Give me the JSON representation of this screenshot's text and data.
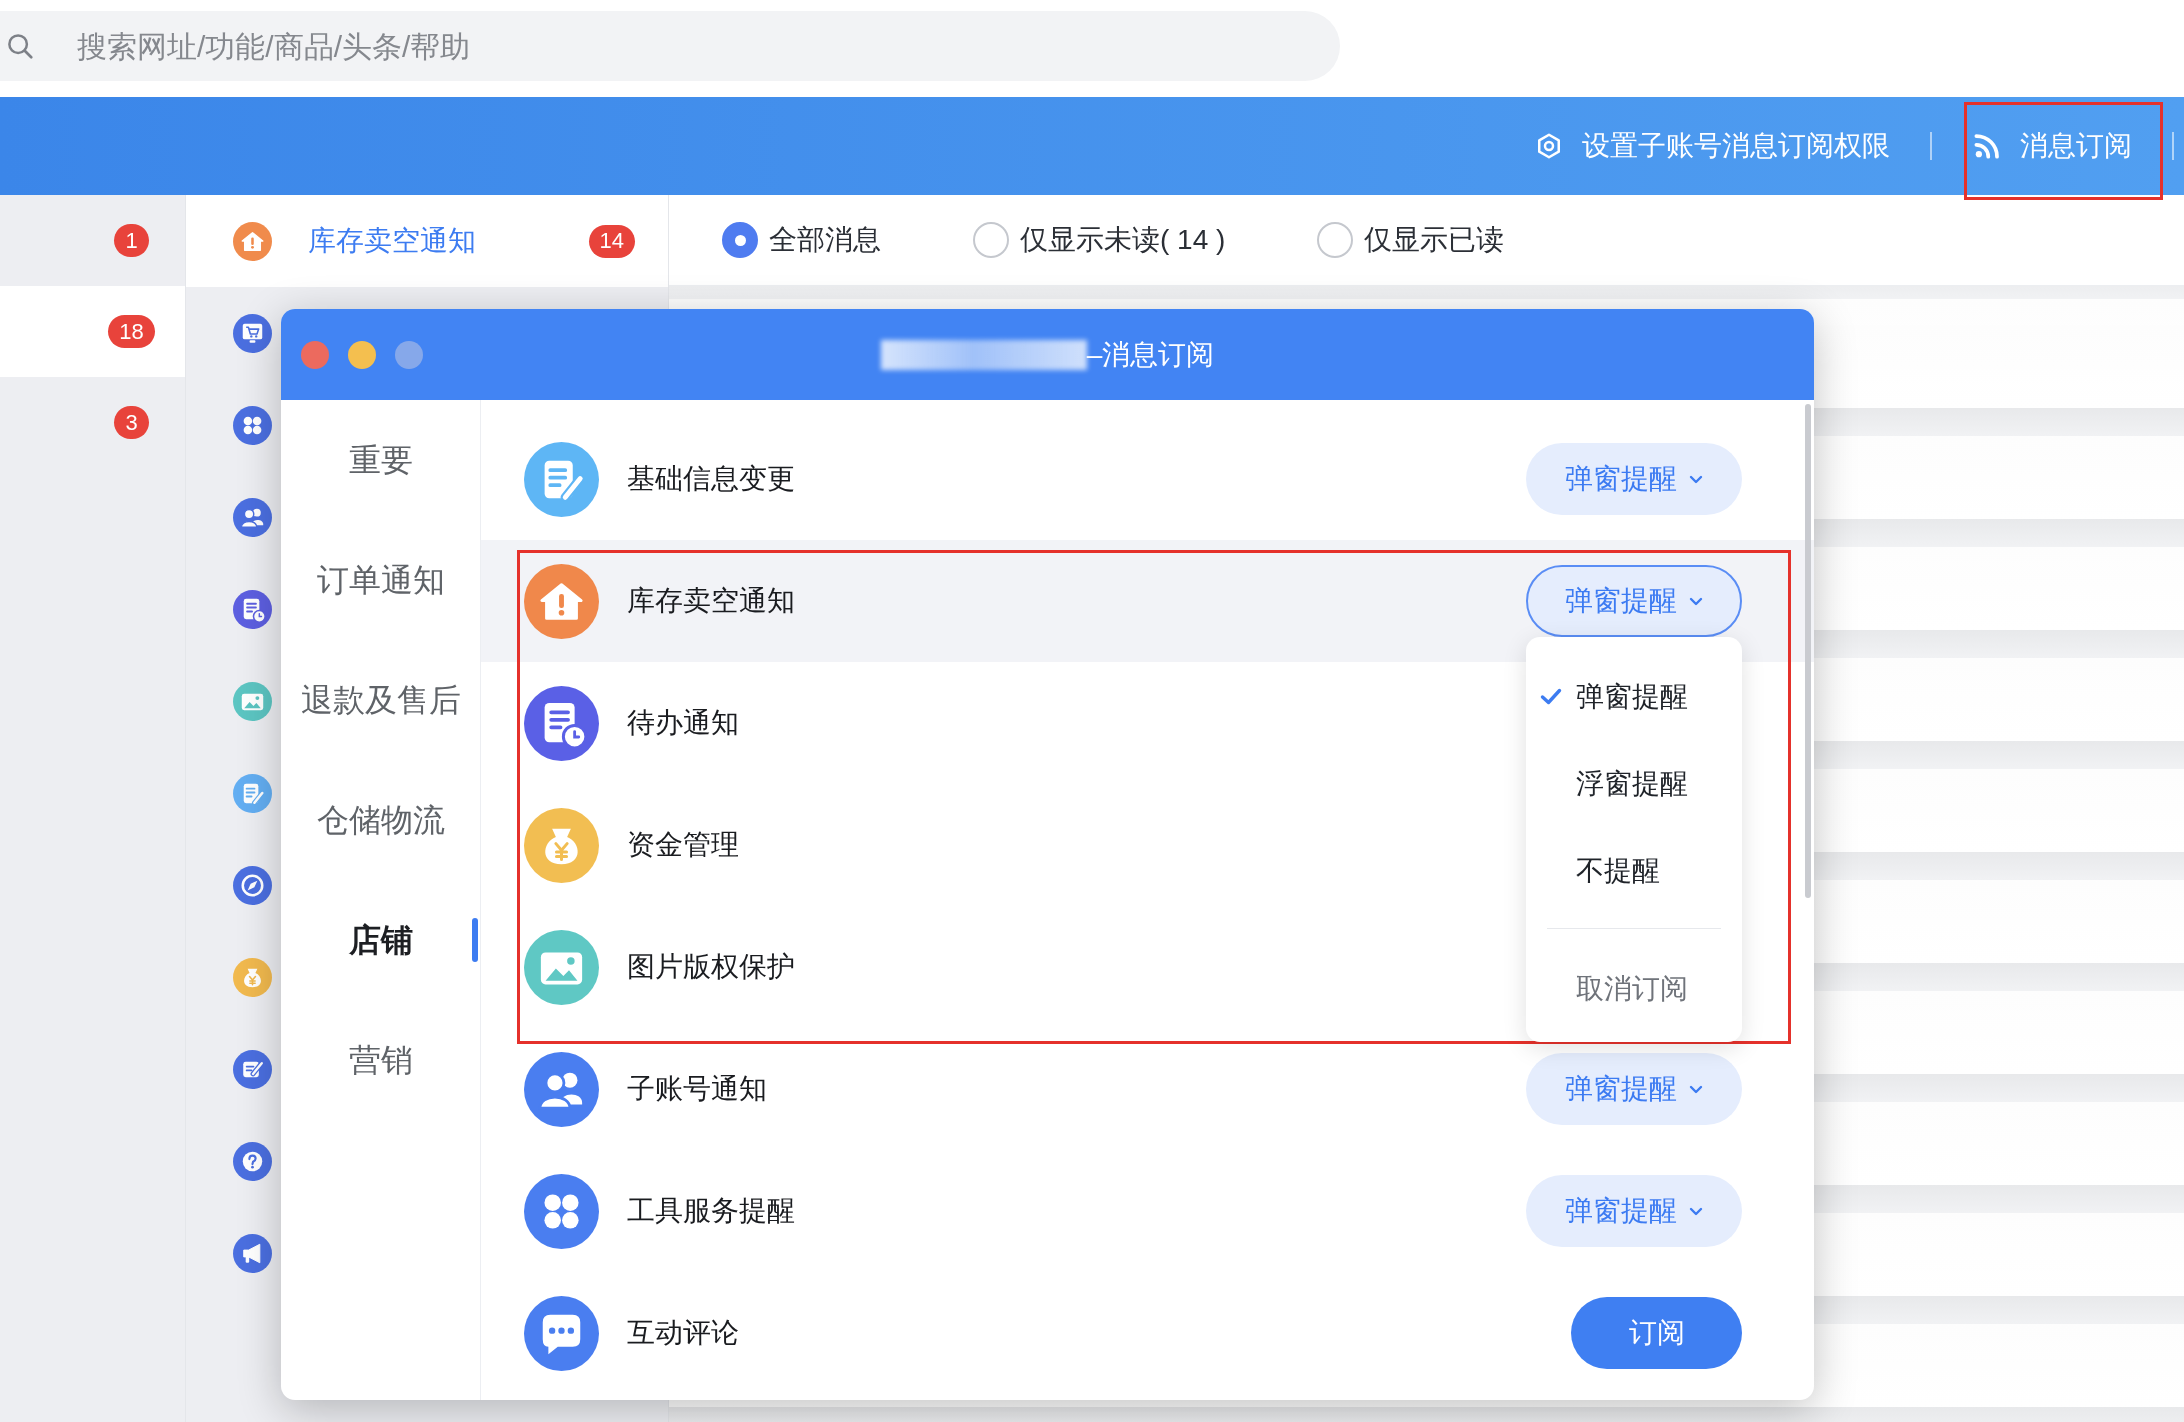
{
  "search": {
    "placeholder": "搜索网址/功能/商品/头条/帮助"
  },
  "header_links": [
    {
      "kind": "settings",
      "label": "设置子账号消息订阅权限",
      "highlighted": false
    },
    {
      "kind": "feed",
      "label": "消息订阅",
      "highlighted": true
    }
  ],
  "category_list": [
    {
      "badge": "1",
      "selected": false
    },
    {
      "badge": "18",
      "selected": true
    },
    {
      "badge": "3",
      "selected": false
    }
  ],
  "topic_list": [
    {
      "kind": "stock",
      "color": "#f08b4c",
      "label": "库存卖空通知",
      "badge": "14",
      "selected": true
    },
    {
      "kind": "cart",
      "color": "#4b6fe0",
      "selected": false
    },
    {
      "kind": "tools",
      "color": "#4b6fe0",
      "selected": false
    },
    {
      "kind": "accounts",
      "color": "#4b6fe0",
      "selected": false
    },
    {
      "kind": "todo",
      "color": "#5d5fe0",
      "selected": false
    },
    {
      "kind": "image",
      "color": "#5cc5c2",
      "selected": false
    },
    {
      "kind": "document",
      "color": "#63aef2",
      "selected": false
    },
    {
      "kind": "compass",
      "color": "#4b6fe0",
      "selected": false
    },
    {
      "kind": "funds",
      "color": "#f1b94e",
      "selected": false
    },
    {
      "kind": "edit",
      "color": "#4b6fe0",
      "selected": false
    },
    {
      "kind": "help",
      "color": "#4b6fe0",
      "selected": false
    },
    {
      "kind": "megaphone",
      "color": "#4b6fe0",
      "selected": false
    }
  ],
  "filters": [
    {
      "label": "全部消息",
      "selected": true
    },
    {
      "label": "仅显示未读( 14 )",
      "selected": false
    },
    {
      "label": "仅显示已读",
      "selected": false
    }
  ],
  "dialog": {
    "window_buttons": [
      {
        "kind": "close",
        "disabled": false
      },
      {
        "kind": "minimize",
        "disabled": false
      },
      {
        "kind": "zoom",
        "disabled": true
      }
    ],
    "title_redacted": true,
    "title": "–消息订阅",
    "nav": [
      {
        "label": "重要",
        "selected": false
      },
      {
        "label": "订单通知",
        "selected": false
      },
      {
        "label": "退款及售后",
        "selected": false
      },
      {
        "label": "仓储物流",
        "selected": false
      },
      {
        "label": "店铺",
        "selected": true
      },
      {
        "label": "营销",
        "selected": false
      }
    ],
    "groups": [
      {
        "highlighted": false,
        "rows": [
          {
            "kind": "document",
            "color": "#5eb6f5",
            "label": "基础信息变更",
            "expanded": false,
            "action": {
              "kind": "dropdown",
              "label": "弹窗提醒"
            }
          }
        ]
      },
      {
        "highlighted": true,
        "rows": [
          {
            "kind": "stock",
            "color": "#f0884b",
            "label": "库存卖空通知",
            "expanded": true,
            "action": {
              "kind": "dropdown",
              "label": "弹窗提醒",
              "menu": [
                {
                  "kind": "option",
                  "label": "弹窗提醒",
                  "checked": true
                },
                {
                  "kind": "option",
                  "label": "浮窗提醒",
                  "checked": false
                },
                {
                  "kind": "option",
                  "label": "不提醒",
                  "checked": false
                },
                {
                  "kind": "divider"
                },
                {
                  "kind": "action",
                  "label": "取消订阅"
                }
              ]
            }
          },
          {
            "kind": "todo",
            "color": "#5a60e6",
            "label": "待办通知",
            "expanded": false
          },
          {
            "kind": "funds",
            "color": "#f2be52",
            "label": "资金管理",
            "expanded": false
          },
          {
            "kind": "image",
            "color": "#5fc8c4",
            "label": "图片版权保护",
            "expanded": false
          }
        ]
      },
      {
        "highlighted": false,
        "rows": [
          {
            "kind": "accounts",
            "color": "#4a7ef0",
            "label": "子账号通知",
            "expanded": false,
            "action": {
              "kind": "dropdown",
              "label": "弹窗提醒"
            }
          },
          {
            "kind": "tools",
            "color": "#4a7ef0",
            "label": "工具服务提醒",
            "expanded": false,
            "action": {
              "kind": "dropdown",
              "label": "弹窗提醒"
            }
          },
          {
            "kind": "comment",
            "color": "#4a7ef0",
            "label": "互动评论",
            "expanded": false,
            "action": {
              "kind": "button",
              "label": "订阅"
            }
          }
        ]
      }
    ]
  }
}
